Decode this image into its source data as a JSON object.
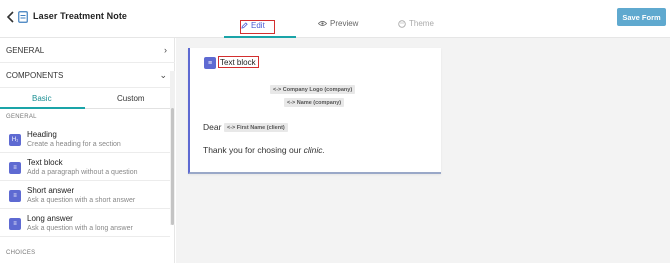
{
  "header": {
    "title": "Laser Treatment Note",
    "tabs": [
      {
        "label": "Edit",
        "icon": "pencil-icon",
        "active": true
      },
      {
        "label": "Preview",
        "icon": "eye-icon",
        "active": false
      },
      {
        "label": "Theme",
        "icon": "palette-icon",
        "active": false
      }
    ],
    "save_label": "Save Form"
  },
  "sidebar": {
    "sections": [
      {
        "label": "GENERAL",
        "chevron": ">"
      },
      {
        "label": "COMPONENTS",
        "chevron": "v"
      }
    ],
    "subtabs": [
      "Basic",
      "Custom"
    ],
    "group_label": "GENERAL",
    "items": [
      {
        "title": "Heading",
        "desc": "Create a heading for a section",
        "icon": "heading-icon"
      },
      {
        "title": "Text block",
        "desc": "Add a paragraph without a question",
        "icon": "text-block-icon"
      },
      {
        "title": "Short answer",
        "desc": "Ask a question with a short answer",
        "icon": "short-answer-icon"
      },
      {
        "title": "Long answer",
        "desc": "Ask a question with a long answer",
        "icon": "long-answer-icon"
      }
    ],
    "next_group_label": "CHOICES"
  },
  "canvas": {
    "block_title": "Text block",
    "company_logo_chip": "<-> Company Logo (company)",
    "company_name_chip": "<-> Name (company)",
    "dear_text": "Dear",
    "first_name_chip": "<-> First Name (client)",
    "thanks_prefix": "Thank you for chosing our ",
    "thanks_emphasis": "clinic."
  },
  "colors": {
    "accent": "#1aa4a8",
    "icon_bg": "#5e6ad2",
    "save_button": "#5fa9cf",
    "highlight_box": "#d32f2f"
  }
}
